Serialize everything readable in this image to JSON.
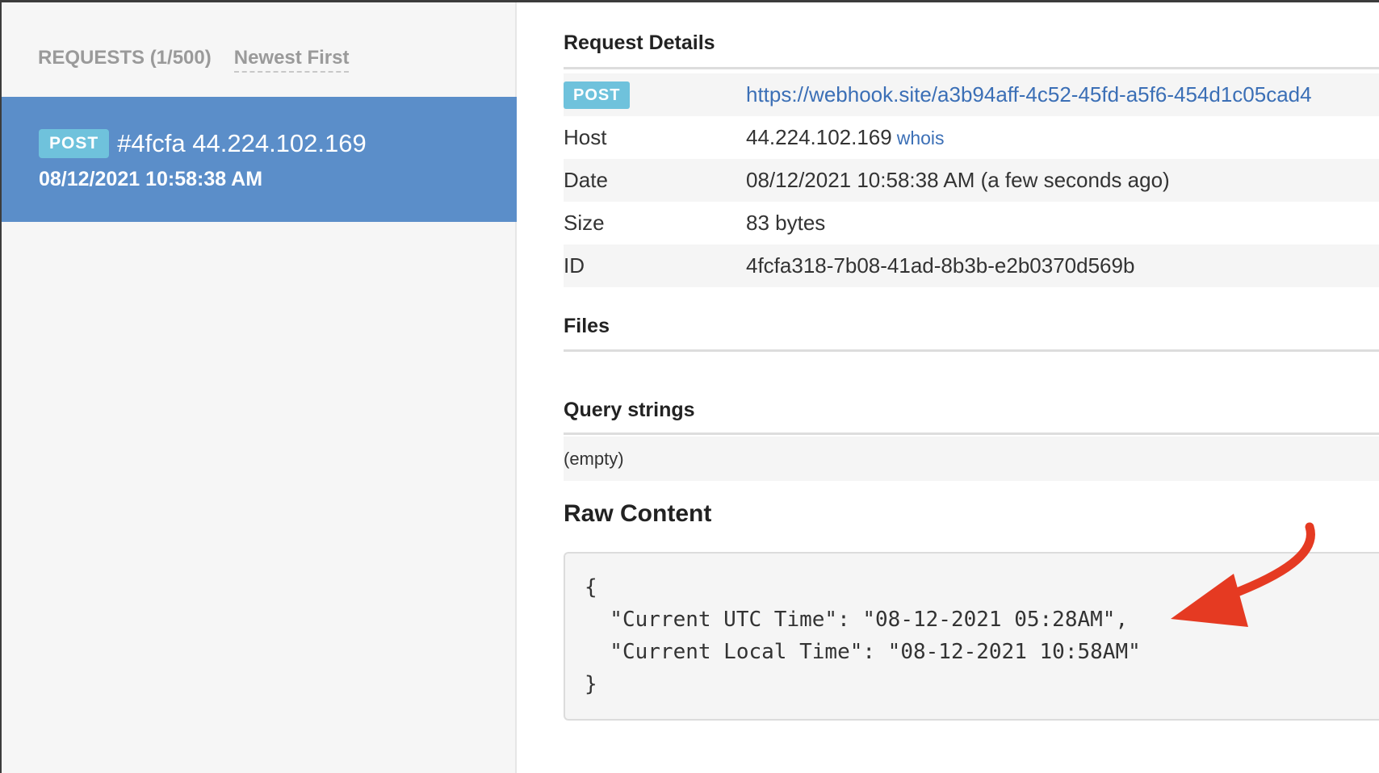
{
  "sidebar": {
    "requests_count_label": "REQUESTS (1/500)",
    "sort_label": "Newest First",
    "selected_request": {
      "method": "POST",
      "title": "#4fcfa 44.224.102.169",
      "date": "08/12/2021 10:58:38 AM"
    }
  },
  "details": {
    "title": "Request Details",
    "method": "POST",
    "url": "https://webhook.site/a3b94aff-4c52-45fd-a5f6-454d1c05cad4",
    "rows": [
      {
        "key": "Host",
        "value": "44.224.102.169",
        "extra": "whois"
      },
      {
        "key": "Date",
        "value": "08/12/2021 10:58:38 AM (a few seconds ago)"
      },
      {
        "key": "Size",
        "value": "83 bytes"
      },
      {
        "key": "ID",
        "value": "4fcfa318-7b08-41ad-8b3b-e2b0370d569b"
      }
    ]
  },
  "files": {
    "title": "Files"
  },
  "query": {
    "title": "Query strings",
    "empty_text": "(empty)"
  },
  "raw": {
    "title": "Raw Content",
    "content": "{\n  \"Current UTC Time\": \"08-12-2021 05:28AM\",\n  \"Current Local Time\": \"08-12-2021 10:58AM\"\n}"
  },
  "annotation": {
    "icon": "red-arrow-icon",
    "color": "#e53a22"
  }
}
